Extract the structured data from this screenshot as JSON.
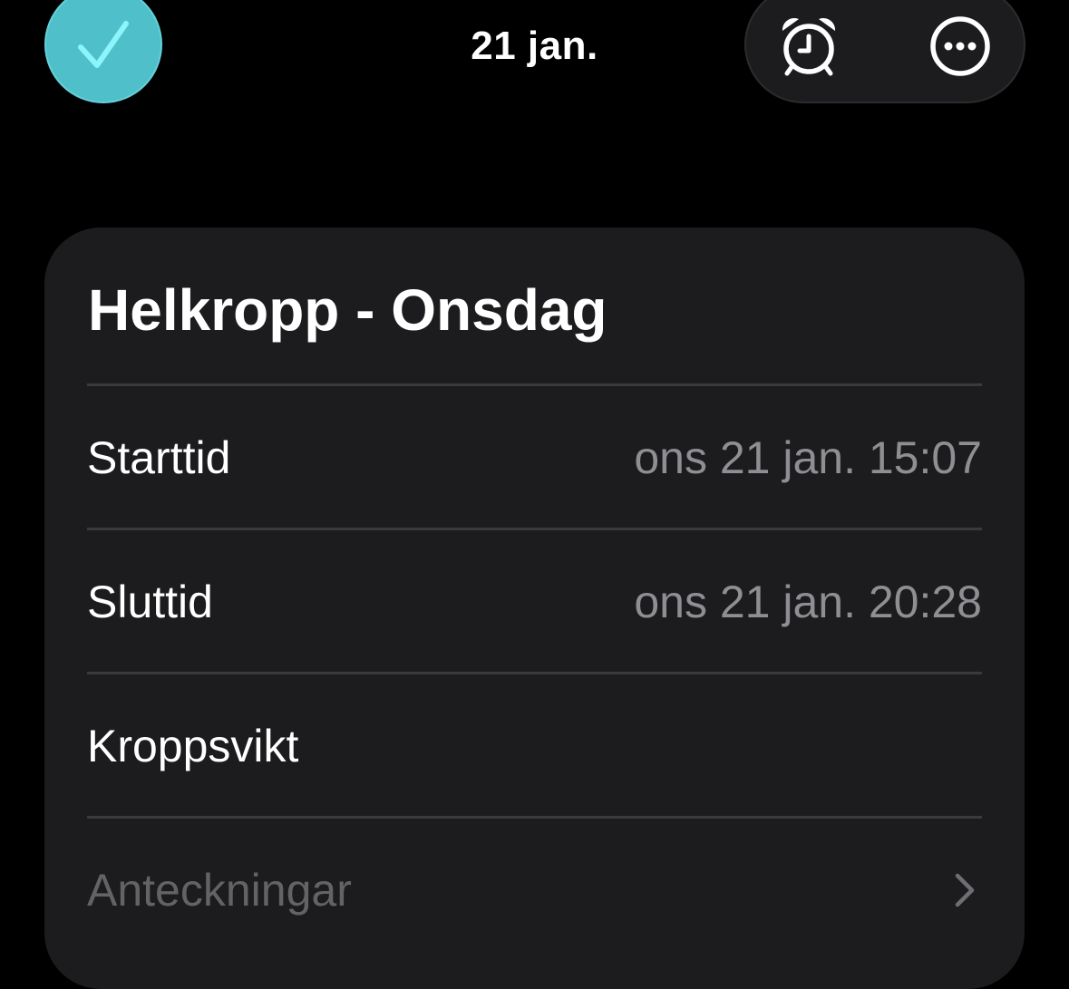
{
  "header": {
    "date_title": "21 jan.",
    "done_icon": "checkmark-icon",
    "alarm_icon": "alarm-clock-icon",
    "more_icon": "ellipsis-circle-icon"
  },
  "workout": {
    "title": "Helkropp - Onsdag",
    "rows": [
      {
        "label": "Starttid",
        "value": "ons 21 jan. 15:07"
      },
      {
        "label": "Sluttid",
        "value": "ons 21 jan. 20:28"
      },
      {
        "label": "Kroppsvikt",
        "value": ""
      },
      {
        "label": "Anteckningar",
        "value": ""
      }
    ]
  },
  "colors": {
    "accent": "#4fbfca",
    "accent_check": "#8cf4fb",
    "background": "#000000",
    "card": "#1c1c1e",
    "secondary_text": "#8e8e93",
    "placeholder_text": "#636366"
  }
}
